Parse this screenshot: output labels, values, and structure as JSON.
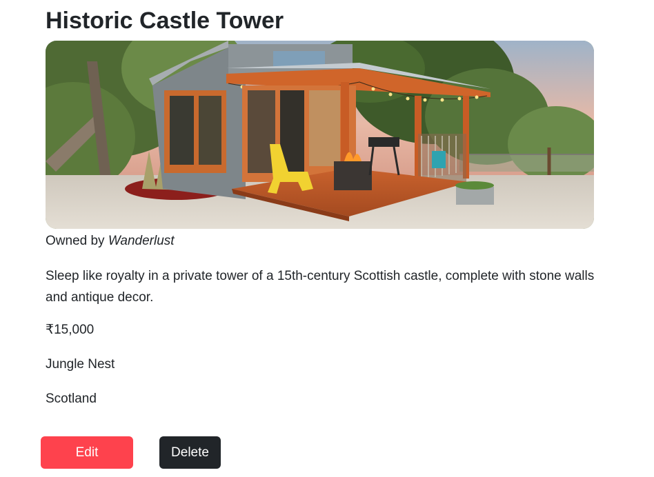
{
  "listing": {
    "title": "Historic Castle Tower",
    "image_alt": "Tiny wooden cabin with a covered porch, string lights, a yellow chair and a fire table on gravel among trees",
    "owner_prefix": "Owned by ",
    "owner_name": "Wanderlust",
    "description": "Sleep like royalty in a private tower of a 15th-century Scottish castle, complete with stone walls and antique decor.",
    "price": "₹15,000",
    "category": "Jungle Nest",
    "country": "Scotland"
  },
  "actions": {
    "edit_label": "Edit",
    "delete_label": "Delete"
  },
  "colors": {
    "edit_button": "#fe424d",
    "delete_button": "#212529",
    "text": "#212529"
  }
}
